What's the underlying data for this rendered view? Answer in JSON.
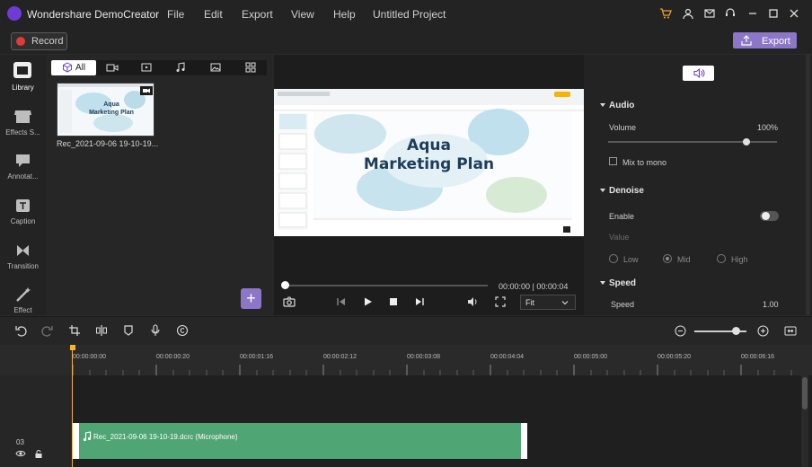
{
  "app": {
    "title": "Wondershare DemoCreator",
    "project": "Untitled Project",
    "menu": [
      "File",
      "Edit",
      "Export",
      "View",
      "Help"
    ]
  },
  "toolbar": {
    "record_label": "Record",
    "export_label": "Export"
  },
  "leftnav": [
    "Library",
    "Effects S...",
    "Annotat...",
    "Caption",
    "Transition",
    "Effect"
  ],
  "library": {
    "tab_all": "All",
    "media": [
      {
        "name": "Rec_2021-09-06 19-10-19..."
      }
    ]
  },
  "preview": {
    "slide_title_line1": "Aqua",
    "slide_title_line2": "Marketing Plan",
    "timecode": "00:00:00 | 00:00:04",
    "fit": "Fit"
  },
  "properties": {
    "audio": {
      "title": "Audio",
      "volume_label": "Volume",
      "volume_value": "100%",
      "volume_fraction": 0.8,
      "mix_label": "Mix to mono"
    },
    "denoise": {
      "title": "Denoise",
      "enable_label": "Enable",
      "value_label": "Value",
      "options": [
        "Low",
        "Mid",
        "High"
      ],
      "selected": "Mid"
    },
    "speed": {
      "title": "Speed",
      "label": "Speed",
      "value": "1.00"
    }
  },
  "timeline": {
    "ticks": [
      "00:00:00:00",
      "00:00:00:20",
      "00:00:01:16",
      "00:00:02:12",
      "00:00:03:08",
      "00:00:04:04",
      "00:00:05:00",
      "00:00:05:20",
      "00:00:06:16"
    ],
    "track_number": "03",
    "clip_label": "Rec_2021-09-06 19-10-19.dcrc (Microphone)"
  },
  "colors": {
    "accent": "#8c76c8",
    "clip": "#4fa573",
    "playhead": "#f3b23a",
    "record": "#e03a3a"
  }
}
